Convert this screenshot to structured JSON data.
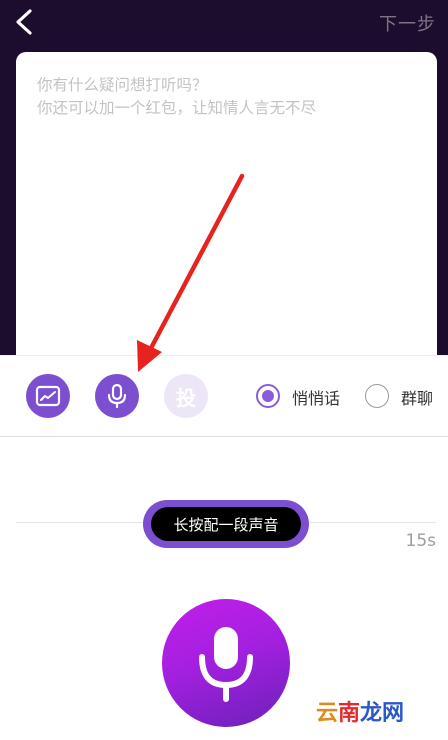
{
  "header": {
    "next_label": "下一步"
  },
  "compose": {
    "placeholder": "你有什么疑问想打听吗？\n你还可以加一个红包，让知情人言无不尽"
  },
  "toolbar": {
    "vote_label": "投",
    "options": [
      {
        "label": "悄悄话",
        "selected": true
      },
      {
        "label": "群聊",
        "selected": false
      }
    ]
  },
  "recorder": {
    "hint": "长按配一段声音",
    "duration": "15s"
  },
  "watermark": {
    "part1": "云",
    "part2": "南",
    "part3": "龙网"
  },
  "colors": {
    "header_bg": "#1c0d2e",
    "accent": "#7b4fd0",
    "annotation_arrow": "#e8231f"
  },
  "icons": {
    "back": "chevron-left-icon",
    "image": "image-icon",
    "voice": "microphone-icon",
    "record": "microphone-icon"
  }
}
